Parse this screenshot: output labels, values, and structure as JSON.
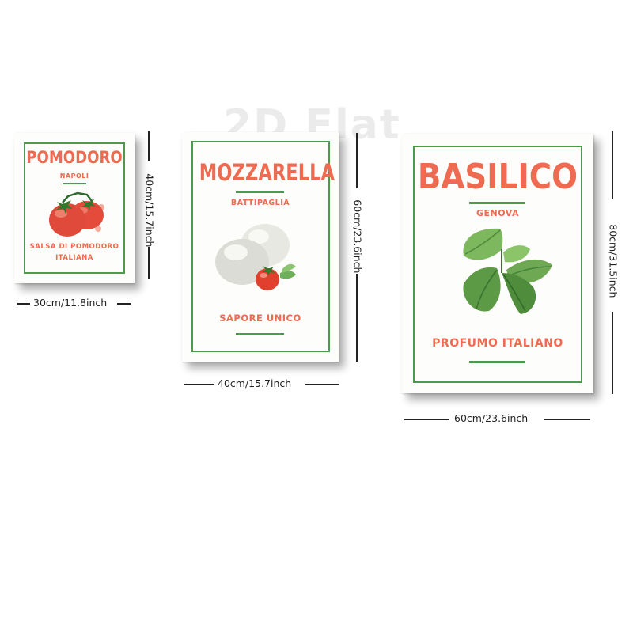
{
  "watermark": "2D Flat",
  "posters": [
    {
      "title": "POMODORO",
      "subtitle": "NAPOLI",
      "tagline_line1": "SALSA DI POMODORO",
      "tagline_line2": "ITALIANA",
      "illustration": "tomato-icon",
      "width_label": "30cm/11.8inch",
      "height_label": "40cm/15.7inch"
    },
    {
      "title": "MOZZARELLA",
      "subtitle": "BATTIPAGLIA",
      "tagline": "SAPORE UNICO",
      "illustration": "mozzarella-icon",
      "width_label": "40cm/15.7inch",
      "height_label": "60cm/23.6inch"
    },
    {
      "title": "BASILICO",
      "subtitle": "GENOVA",
      "tagline": "PROFUMO ITALIANO",
      "illustration": "basil-icon",
      "width_label": "60cm/23.6inch",
      "height_label": "80cm/31.5inch"
    }
  ],
  "colors": {
    "title_red": "#ee6a50",
    "frame_green": "#4c9a4b",
    "dimension_line": "#222222"
  }
}
